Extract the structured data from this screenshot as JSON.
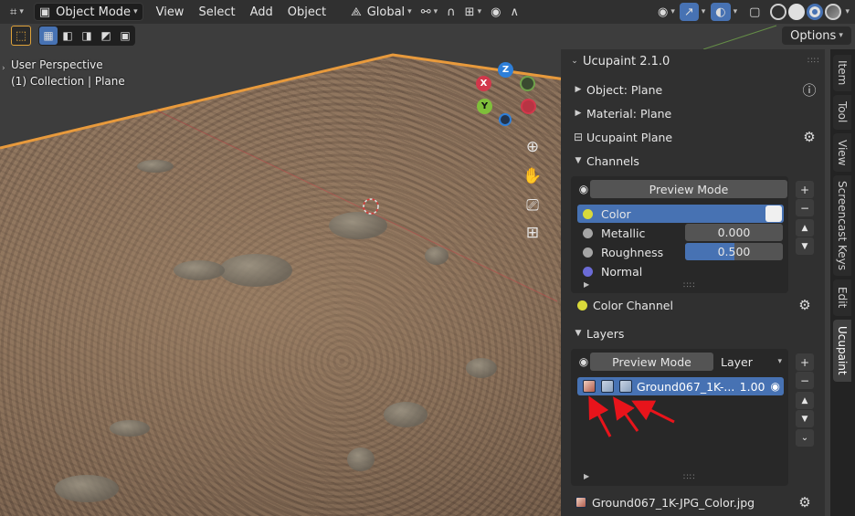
{
  "header": {
    "mode": "Object Mode",
    "menus": [
      "View",
      "Select",
      "Add",
      "Object"
    ],
    "transform_orientation": "Global",
    "options_label": "Options"
  },
  "viewport": {
    "perspective": "User Perspective",
    "collection": "(1) Collection | Plane",
    "gizmo": {
      "z": "Z",
      "x": "X",
      "y": "Y"
    }
  },
  "panel": {
    "title": "Ucupaint 2.1.0",
    "object_label": "Object: Plane",
    "material_label": "Material: Plane",
    "ucupaint_label": "Ucupaint Plane",
    "channels_label": "Channels",
    "channels_preview_label": "Preview Mode",
    "channels": [
      {
        "name": "Color",
        "dot": "#d9d93a",
        "active": true
      },
      {
        "name": "Metallic",
        "dot": "#a5a5a5",
        "value": "0.000",
        "fill": 0.0
      },
      {
        "name": "Roughness",
        "dot": "#a5a5a5",
        "value": "0.500",
        "fill": 0.5
      },
      {
        "name": "Normal",
        "dot": "#6b6bd6"
      }
    ],
    "color_channel_label": "Color Channel",
    "layers_label": "Layers",
    "layers_preview_label": "Preview Mode",
    "layer_dropdown": "Layer",
    "layer": {
      "name": "Ground067_1K-...",
      "opacity": "1.00"
    },
    "image_name": "Ground067_1K-JPG_Color.jpg"
  },
  "tabs": [
    "Item",
    "Tool",
    "View",
    "Screencast Keys",
    "Edit",
    "Ucupaint"
  ],
  "colors": {
    "accent": "#4772b3",
    "annotation_arrow": "#e8141b",
    "selection_outline": "#e89a3c"
  }
}
